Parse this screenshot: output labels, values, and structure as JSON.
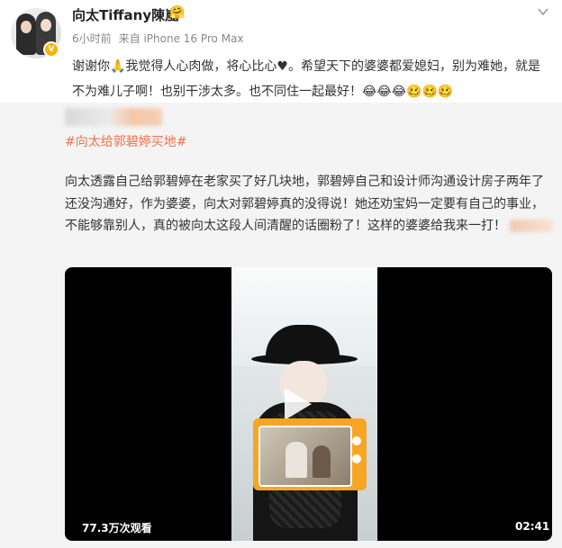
{
  "author": {
    "name": "向太Tiffany陳嵐",
    "name_emoji": "🤗",
    "verified_badge_color": "#f7b500"
  },
  "meta": {
    "time": "6小时前",
    "source": "来自 iPhone 16 Pro Max"
  },
  "post": {
    "text": "谢谢你🙏我觉得人心肉做，将心比心♥。希望天下的婆婆都爱媳妇，别为难她，就是不为难儿子啊！也别干涉太多。也不同住一起最好！😂😂😂🥴🥴🥴"
  },
  "repost": {
    "topic": "#向太给郭碧婷买地#",
    "text": "向太透露自己给郭碧婷在老家买了好几块地，郭碧婷自己和设计师沟通设计房子两年了还没沟通好，作为婆婆，向太对郭碧婷真的没得说！她还劝宝妈一定要有自己的事业，不能够靠别人，真的被向太这段人间清醒的话圈粉了！这样的婆婆给我来一打！"
  },
  "video": {
    "views": "77.3万次观看",
    "duration": "02:41"
  },
  "icons": [
    "chevron-down-icon",
    "play-icon",
    "verified-icon"
  ],
  "colors": {
    "topic": "#eb7350",
    "repost_bg": "#f4f4f4"
  }
}
